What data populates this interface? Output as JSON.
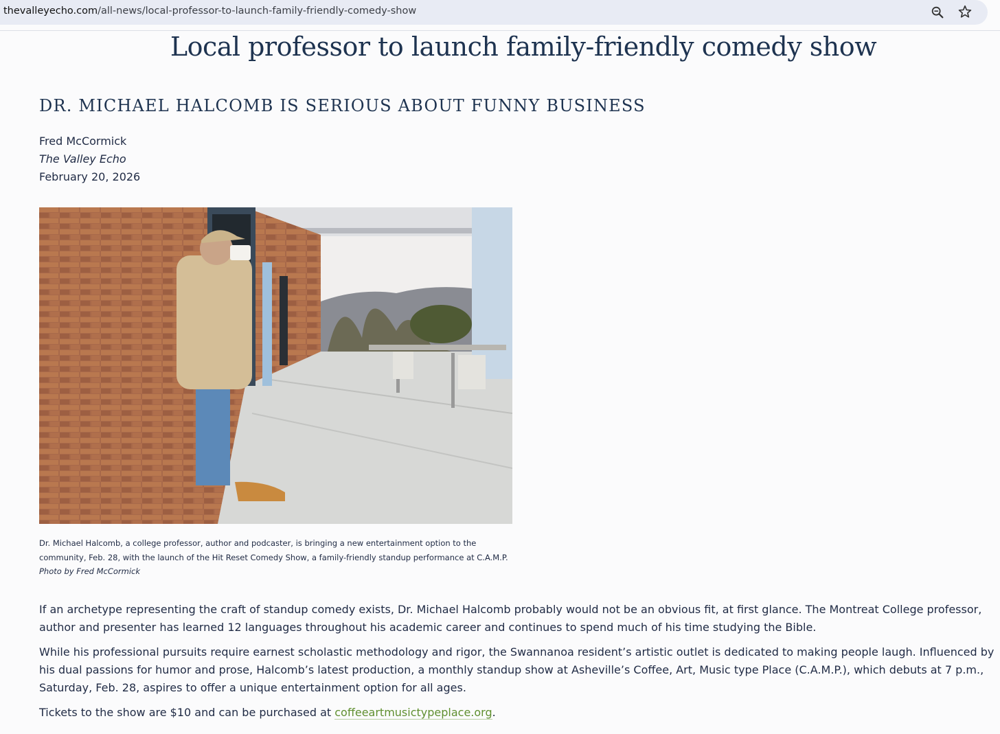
{
  "browser": {
    "url_host": "thevalleyecho.com",
    "url_path": "/all-news/local-professor-to-launch-family-friendly-comedy-show",
    "icons": [
      "zoom-icon",
      "star-icon"
    ]
  },
  "article": {
    "headline": "Local professor to launch family-friendly comedy show",
    "subhead": "DR. MICHAEL HALCOMB IS SERIOUS ABOUT FUNNY BUSINESS",
    "author": "Fred McCormick",
    "publication": "The Valley Echo",
    "date": "February 20, 2026",
    "caption": "Dr. Michael Halcomb, a college professor, author and podcaster, is bringing a new entertainment option to the community, Feb. 28, with the launch of the Hit Reset Comedy Show, a family-friendly standup performance at C.A.M.P.",
    "photo_credit": "Photo by Fred McCormick",
    "paragraphs": [
      "If an archetype representing the craft of standup comedy exists, Dr. Michael Halcomb probably would not be an obvious fit, at first glance. The Montreat College professor, author and presenter has learned 12 languages throughout his academic career and continues to spend much of his time studying the Bible.",
      "While his professional pursuits require earnest scholastic methodology and rigor, the Swannanoa resident’s artistic outlet is dedicated to making people laugh. Influenced by his dual passions for humor and prose, Halcomb’s latest production, a monthly standup show at Asheville’s Coffee, Art, Music type Place (C.A.M.P.), which debuts at 7 p.m., Saturday, Feb. 28, aspires to offer a unique entertainment option for all ages."
    ],
    "tickets_prefix": "Tickets to the show are $10 and can be purchased at ",
    "tickets_link": "coffeeartmusictypeplace.org",
    "tickets_suffix": "."
  },
  "colors": {
    "headline": "#1e3350",
    "link": "#5f8f2f",
    "urlbar": "#e8ebf4"
  }
}
